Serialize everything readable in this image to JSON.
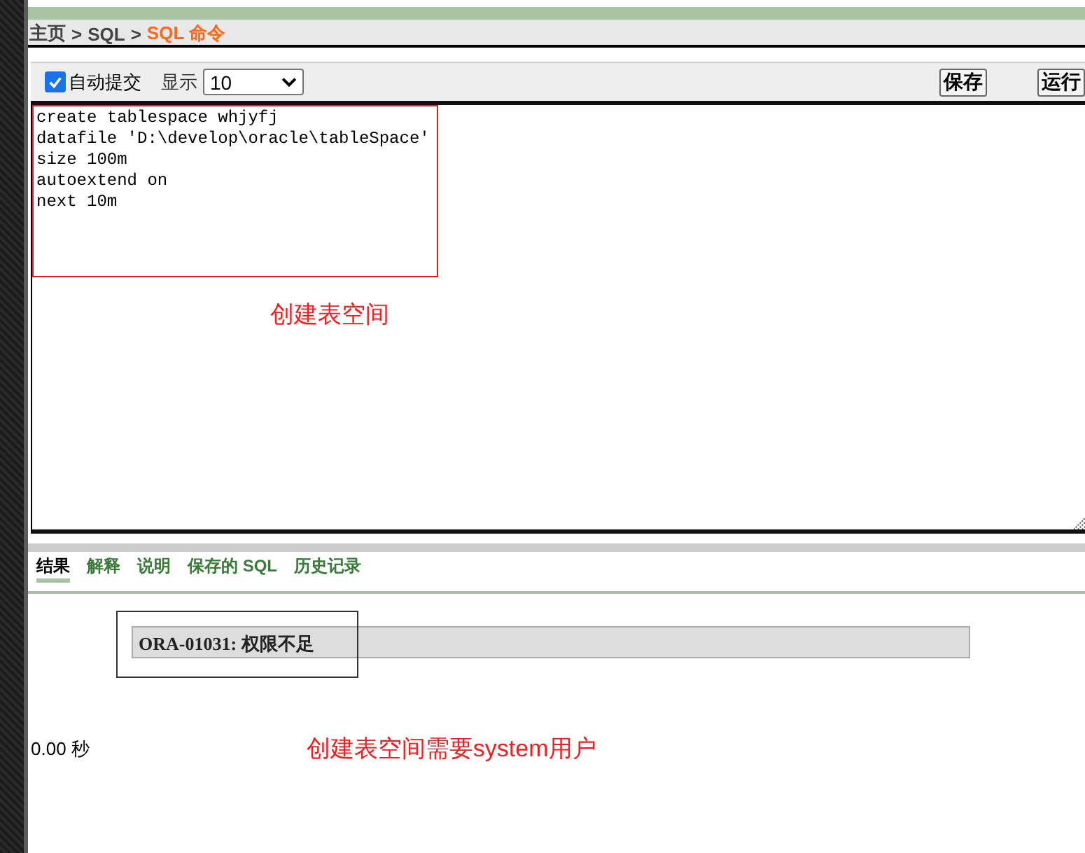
{
  "breadcrumb": [
    {
      "label": "主页",
      "current": false
    },
    {
      "label": "SQL",
      "current": false
    },
    {
      "label": "SQL 命令",
      "current": true
    }
  ],
  "breadcrumb_separator": ">",
  "toolbar": {
    "autocommit": {
      "label": "自动提交",
      "checked": true
    },
    "display": {
      "label": "显示",
      "value": "10"
    },
    "buttons": [
      "保存",
      "运行"
    ]
  },
  "editor": {
    "lines": [
      "create tablespace whjyfj",
      "datafile 'D:\\develop\\oracle\\tableSpace'",
      "size 100m",
      "autoextend on",
      "next 10m"
    ]
  },
  "editor_note": "创建表空间",
  "tabs": [
    {
      "label": "结果",
      "selected": true
    },
    {
      "label": "解释",
      "selected": false
    },
    {
      "label": "说明",
      "selected": false
    },
    {
      "label": "保存的 SQL",
      "selected": false
    },
    {
      "label": "历史记录",
      "selected": false
    }
  ],
  "result": {
    "error": "ORA-01031: 权限不足",
    "elapsed": "0.00 秒"
  },
  "result_note": "创建表空间需要system用户"
}
